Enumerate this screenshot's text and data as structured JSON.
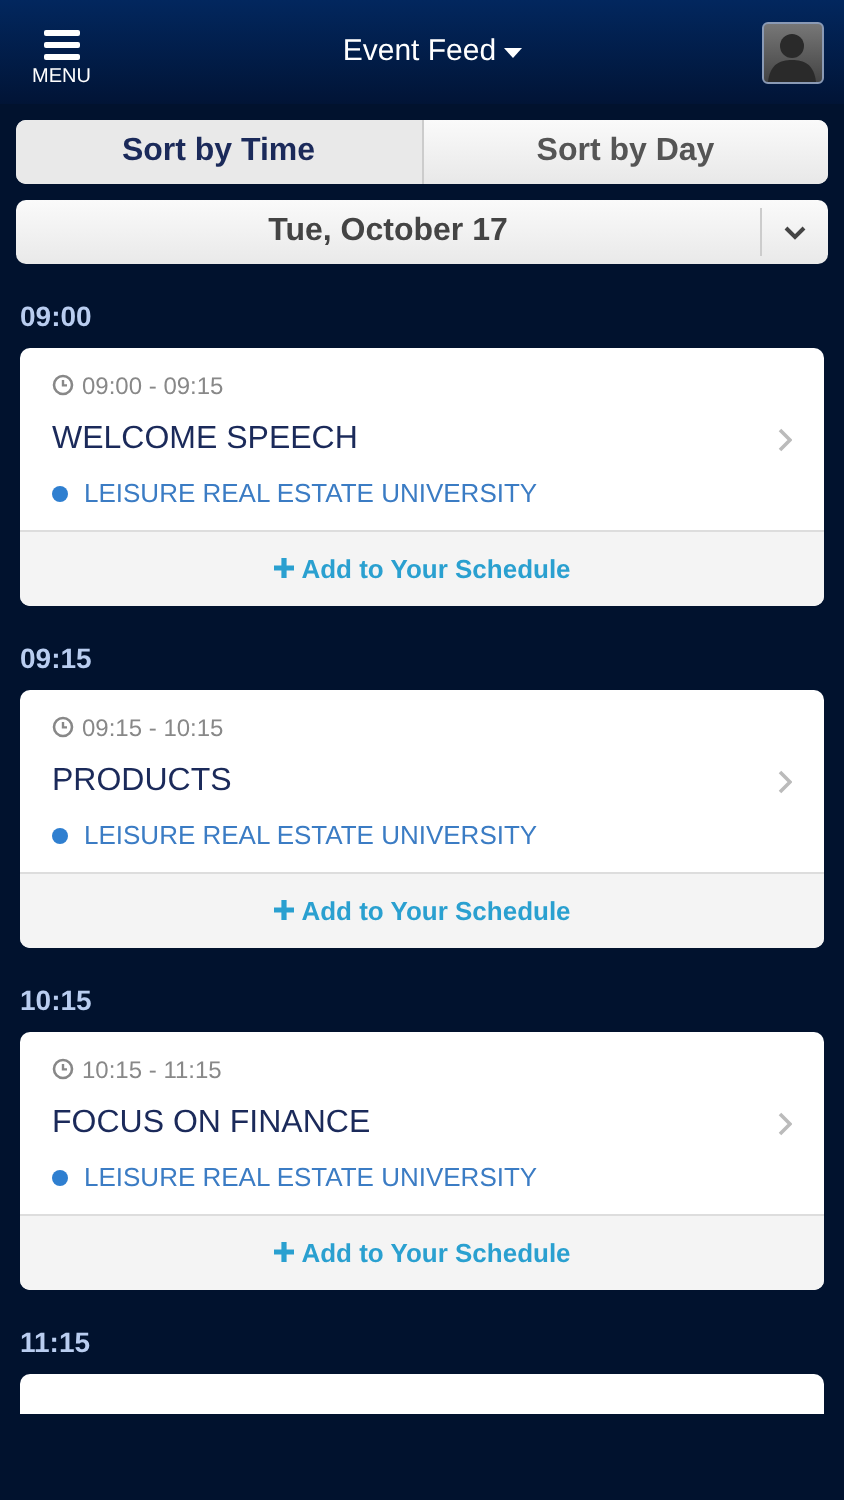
{
  "header": {
    "menu_label": "MENU",
    "title": "Event Feed"
  },
  "sort_tabs": [
    {
      "label": "Sort by Time",
      "selected": true
    },
    {
      "label": "Sort by Day",
      "selected": false
    }
  ],
  "date_picker": {
    "value": "Tue, October 17"
  },
  "sections": [
    {
      "time": "09:00",
      "events": [
        {
          "time_range": "09:00 - 09:15",
          "title": "WELCOME SPEECH",
          "track": "LEISURE REAL ESTATE UNIVERSITY",
          "color": "#2f7fd0",
          "action": "Add to Your Schedule"
        }
      ]
    },
    {
      "time": "09:15",
      "events": [
        {
          "time_range": "09:15 - 10:15",
          "title": "PRODUCTS",
          "track": "LEISURE REAL ESTATE UNIVERSITY",
          "color": "#2f7fd0",
          "action": "Add to Your Schedule"
        }
      ]
    },
    {
      "time": "10:15",
      "events": [
        {
          "time_range": "10:15 - 11:15",
          "title": "FOCUS ON FINANCE",
          "track": "LEISURE REAL ESTATE UNIVERSITY",
          "color": "#2f7fd0",
          "action": "Add to Your Schedule"
        }
      ]
    },
    {
      "time": "11:15"
    }
  ]
}
